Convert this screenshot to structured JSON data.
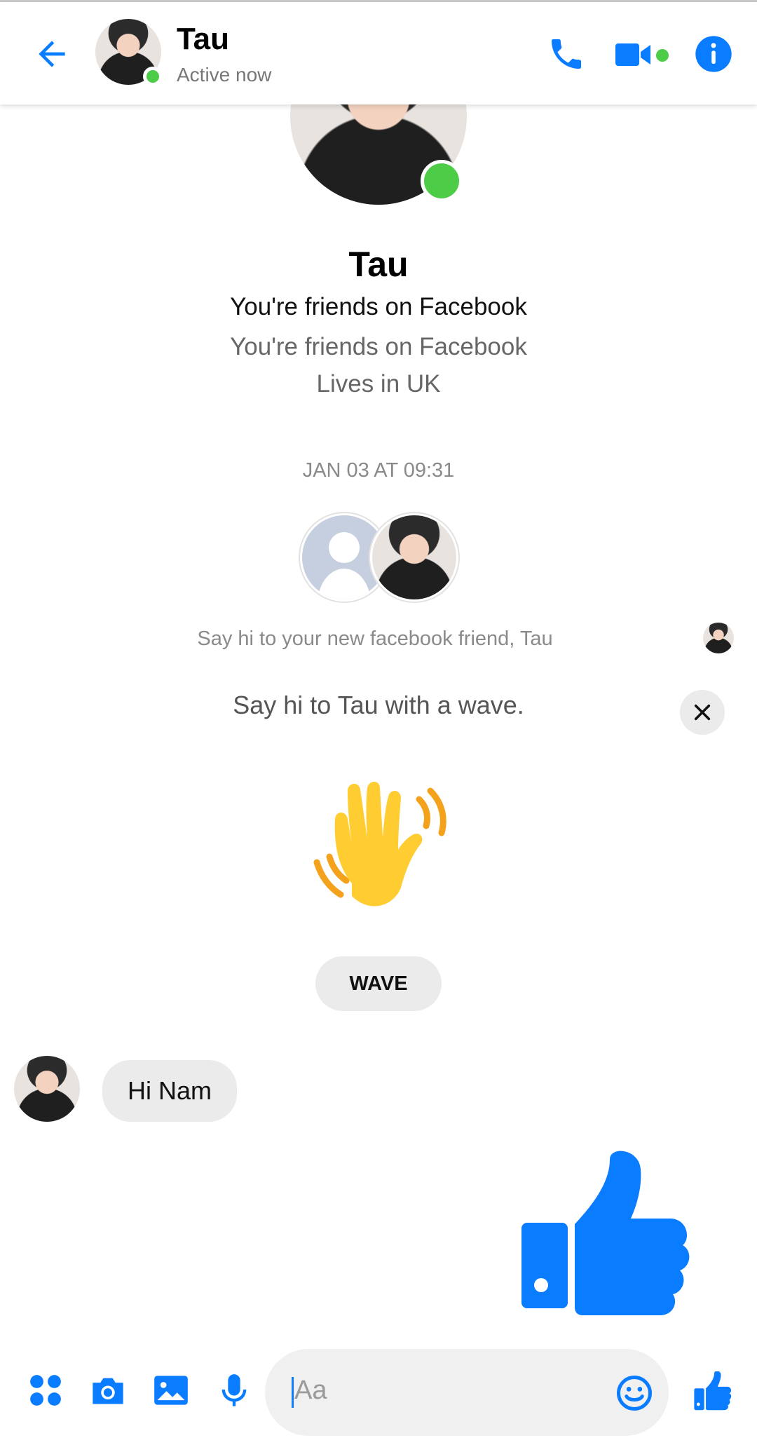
{
  "header": {
    "contact_name": "Tau",
    "status": "Active now"
  },
  "profile": {
    "name": "Tau",
    "line1": "You're friends on Facebook",
    "line2": "You're friends on Facebook",
    "line3": "Lives in UK"
  },
  "conversation": {
    "timestamp": "JAN 03 AT 09:31",
    "new_friend_note": "Say hi to your new facebook friend, Tau",
    "wave_prompt": "Say hi to Tau with a wave.",
    "wave_button": "WAVE",
    "messages": [
      {
        "sender": "Tau",
        "text": "Hi Nam"
      },
      {
        "sender": "me",
        "type": "like-sticker"
      }
    ]
  },
  "composer": {
    "placeholder": "Aa"
  },
  "colors": {
    "accent": "#0a7cff",
    "online": "#4ccc47",
    "bubble": "#ebebeb"
  }
}
